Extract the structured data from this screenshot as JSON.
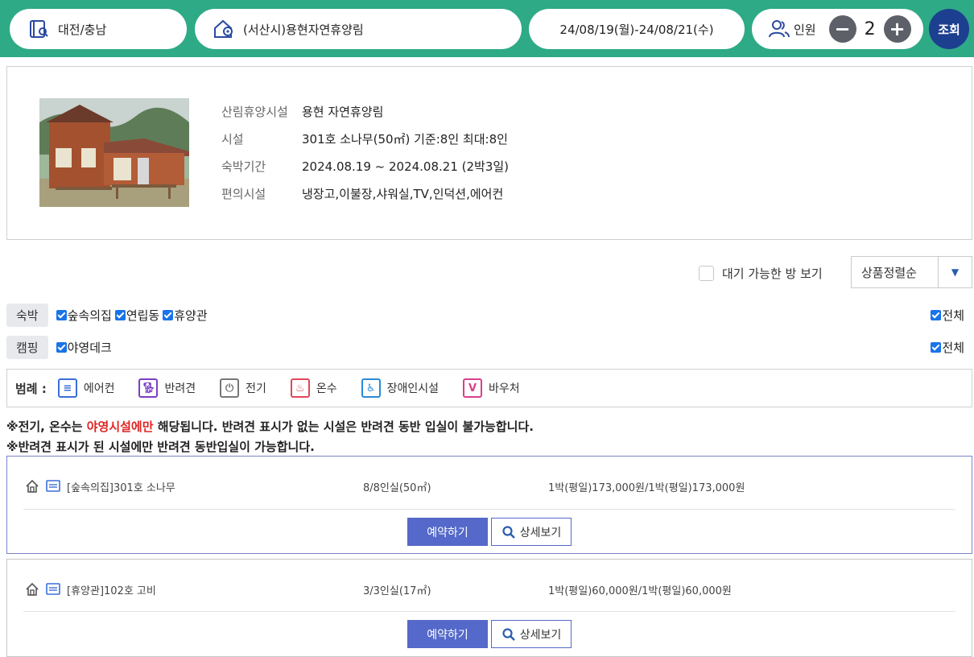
{
  "search": {
    "region": "대전/충남",
    "place": "(서산시)용현자연휴양림",
    "dates": "24/08/19(월)-24/08/21(수)",
    "people_label": "인원",
    "people_count": "2",
    "submit_label": "조회"
  },
  "facility": {
    "rows": [
      {
        "label": "산림휴양시설",
        "value": "용현 자연휴양림"
      },
      {
        "label": "시설",
        "value": "301호 소나무(50㎡) 기준:8인 최대:8인"
      },
      {
        "label": "숙박기간",
        "value": "2024.08.19 ~ 2024.08.21 (2박3일)"
      },
      {
        "label": "편의시설",
        "value": "냉장고,이불장,샤워실,TV,인덕션,에어컨"
      }
    ]
  },
  "controls": {
    "waiting_label": "대기 가능한 방 보기",
    "sort_label": "상품정렬순"
  },
  "filters": {
    "lodging": {
      "tag": "숙박",
      "options": [
        "숲속의집",
        "연립동",
        "휴양관"
      ],
      "all_label": "전체"
    },
    "camping": {
      "tag": "캠핑",
      "options": [
        "야영데크"
      ],
      "all_label": "전체"
    }
  },
  "legend": {
    "title": "범례 :",
    "items": [
      {
        "label": "에어컨",
        "icon": "aircon-icon",
        "color": "#3a6fd8"
      },
      {
        "label": "반려견",
        "icon": "dog-icon",
        "color": "#7b3fc4"
      },
      {
        "label": "전기",
        "icon": "plug-icon",
        "color": "#777777"
      },
      {
        "label": "온수",
        "icon": "hot-water-icon",
        "color": "#e0485a"
      },
      {
        "label": "장애인시설",
        "icon": "wheelchair-icon",
        "color": "#2a8ad8"
      },
      {
        "label": "바우처",
        "icon": "voucher-icon",
        "color": "#d9408a"
      }
    ]
  },
  "notices": {
    "line1_pre": "※전기, 온수는 ",
    "line1_red": "야영시설에만",
    "line1_post": " 해당됩니다. 반려견 표시가 없는 시설은 반려견 동반 입실이 불가능합니다.",
    "line2": "※반려견 표시가 된 시설에만 반려견 동반입실이 가능합니다."
  },
  "rooms": [
    {
      "name": "[숲속의집]301호 소나무",
      "capacity": "8/8인실(50㎡)",
      "price": "1박(평일)173,000원/1박(평일)173,000원",
      "reserve_label": "예약하기",
      "detail_label": "상세보기"
    },
    {
      "name": "[휴양관]102호 고비",
      "capacity": "3/3인실(17㎡)",
      "price": "1박(평일)60,000원/1박(평일)60,000원",
      "reserve_label": "예약하기",
      "detail_label": "상세보기"
    }
  ]
}
